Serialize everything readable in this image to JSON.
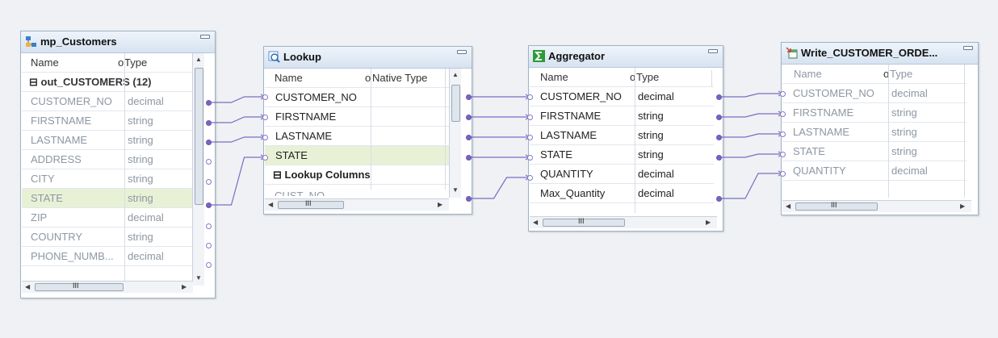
{
  "mp_customers": {
    "title": "mp_Customers",
    "col_name": "Name",
    "col_type": "Type",
    "group": "⊟ out_CUSTOMERS (12)",
    "fields": [
      {
        "name": "CUSTOMER_NO",
        "type": "decimal"
      },
      {
        "name": "FIRSTNAME",
        "type": "string"
      },
      {
        "name": "LASTNAME",
        "type": "string"
      },
      {
        "name": "ADDRESS",
        "type": "string"
      },
      {
        "name": "CITY",
        "type": "string"
      },
      {
        "name": "STATE",
        "type": "string"
      },
      {
        "name": "ZIP",
        "type": "decimal"
      },
      {
        "name": "COUNTRY",
        "type": "string"
      },
      {
        "name": "PHONE_NUMB...",
        "type": "decimal"
      }
    ]
  },
  "lookup": {
    "title": "Lookup",
    "col_name": "Name",
    "col_type": "Native Type",
    "fields": [
      {
        "name": "CUSTOMER_NO"
      },
      {
        "name": "FIRSTNAME"
      },
      {
        "name": "LASTNAME"
      },
      {
        "name": "STATE"
      }
    ],
    "group": "⊟ Lookup Columns",
    "partial_row": "CUST_NO"
  },
  "aggregator": {
    "title": "Aggregator",
    "col_name": "Name",
    "col_type": "Type",
    "fields": [
      {
        "name": "CUSTOMER_NO",
        "type": "decimal"
      },
      {
        "name": "FIRSTNAME",
        "type": "string"
      },
      {
        "name": "LASTNAME",
        "type": "string"
      },
      {
        "name": "STATE",
        "type": "string"
      },
      {
        "name": "QUANTITY",
        "type": "decimal"
      },
      {
        "name": "Max_Quantity",
        "type": "decimal"
      }
    ]
  },
  "write_target": {
    "title": "Write_CUSTOMER_ORDE...",
    "col_name": "Name",
    "col_type": "Type",
    "fields": [
      {
        "name": "CUSTOMER_NO",
        "type": "decimal"
      },
      {
        "name": "FIRSTNAME",
        "type": "string"
      },
      {
        "name": "LASTNAME",
        "type": "string"
      },
      {
        "name": "STATE",
        "type": "string"
      },
      {
        "name": "QUANTITY",
        "type": "decimal"
      }
    ]
  },
  "glyphs": {
    "scroll_grip": "III",
    "port_marker": "o",
    "left_arrow": "◀",
    "right_arrow": "▶",
    "up_arrow": "▲",
    "down_arrow": "▼",
    "lines": "≡"
  },
  "colors": {
    "link": "#7a6cc4",
    "highlight": "#e8f1d6",
    "header": "#dbe6f3"
  }
}
